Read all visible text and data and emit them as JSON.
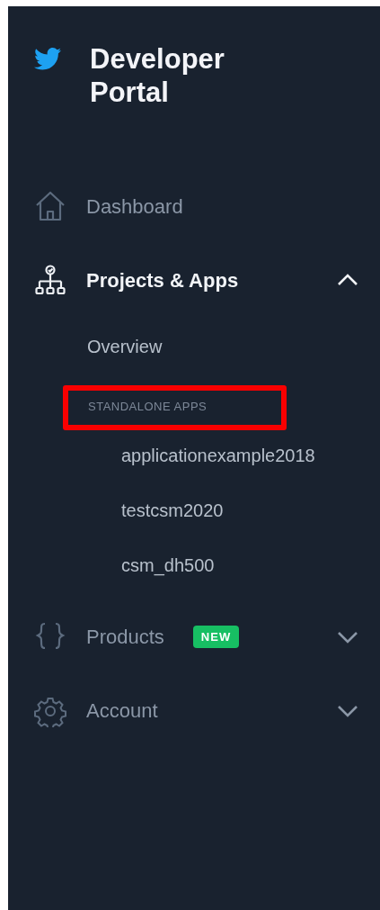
{
  "brand": {
    "title": "Developer Portal"
  },
  "nav": [
    {
      "label": "Dashboard",
      "kind": "link",
      "selected": false
    },
    {
      "label": "Projects & Apps",
      "kind": "group",
      "selected": true,
      "expanded": true,
      "children": [
        {
          "label": "Overview",
          "kind": "link"
        },
        {
          "label": "STANDALONE APPS",
          "kind": "header",
          "highlighted": true,
          "children": [
            {
              "label": "applicationexample2018",
              "kind": "link"
            },
            {
              "label": "testcsm2020",
              "kind": "link"
            },
            {
              "label": "csm_dh500",
              "kind": "link"
            }
          ]
        }
      ]
    },
    {
      "label": "Products",
      "kind": "group",
      "selected": false,
      "expanded": false,
      "badge": "NEW"
    },
    {
      "label": "Account",
      "kind": "group",
      "selected": false,
      "expanded": false
    }
  ]
}
